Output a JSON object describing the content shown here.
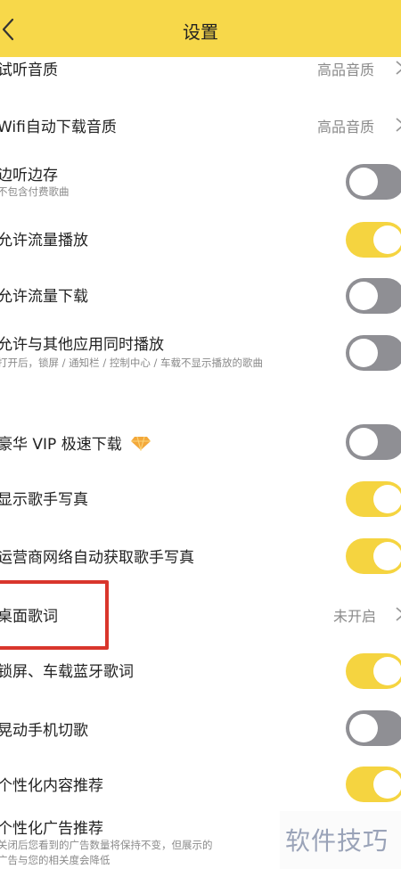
{
  "header": {
    "title": "设置"
  },
  "rows": {
    "trial_quality": {
      "label": "试听音质",
      "value": "高品音质"
    },
    "wifi_download": {
      "label": "Wifi自动下载音质",
      "value": "高品音质"
    },
    "listen_save": {
      "label": "边听边存",
      "sub": "不包含付费歌曲",
      "state": "off"
    },
    "allow_data_play": {
      "label": "允许流量播放",
      "state": "on"
    },
    "allow_data_download": {
      "label": "允许流量下载",
      "state": "off"
    },
    "allow_other_apps": {
      "label": "允许与其他应用同时播放",
      "sub": "打开后，锁屏 / 通知栏 / 控制中心 / 车载不显示播放的歌曲",
      "state": "off"
    },
    "vip_download": {
      "label": "豪华 VIP 极速下载",
      "icon": "diamond-icon",
      "state": "off"
    },
    "show_artist_photo": {
      "label": "显示歌手写真",
      "state": "on"
    },
    "carrier_artist_photo": {
      "label": "运营商网络自动获取歌手写真",
      "state": "on"
    },
    "desktop_lyrics": {
      "label": "桌面歌词",
      "value": "未开启"
    },
    "lockscreen_lyrics": {
      "label": "锁屏、车载蓝牙歌词",
      "state": "on"
    },
    "shake_switch": {
      "label": "晃动手机切歌",
      "state": "off"
    },
    "personal_content": {
      "label": "个性化内容推荐",
      "state": "on"
    },
    "personal_ads": {
      "label": "个性化广告推荐",
      "sub1": "关闭后您看到的广告数量将保持不变，但展示的",
      "sub2": "广告与您的相关度会降低"
    }
  },
  "watermark": "软件技巧",
  "colors": {
    "header": "#f7d84a",
    "toggle_on": "#f5d440",
    "toggle_off": "#8f8f94",
    "highlight": "#d9362c"
  }
}
